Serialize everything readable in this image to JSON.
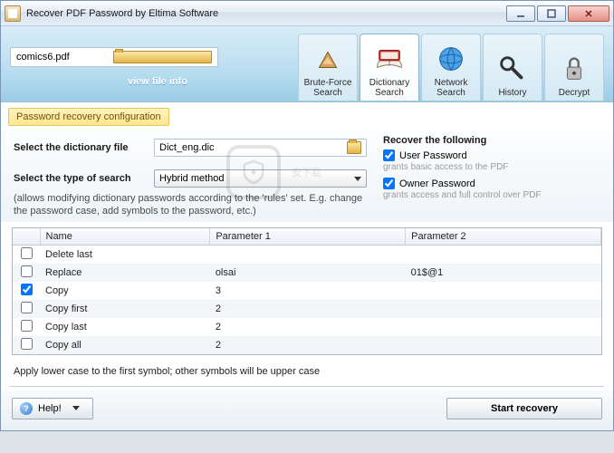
{
  "window": {
    "title": "Recover PDF Password by Eltima Software"
  },
  "file": {
    "name": "comics6.pdf",
    "view_info": "view file info"
  },
  "tabs": {
    "brute": "Brute-Force Search",
    "dict": "Dictionary Search",
    "net": "Network Search",
    "hist": "History",
    "decrypt": "Decrypt"
  },
  "section_title": "Password recovery configuration",
  "labels": {
    "dictfile": "Select the dictionary file",
    "searchtype": "Select the type of search"
  },
  "dictfile": "Dict_eng.dic",
  "searchtype": "Hybrid method",
  "search_note": "(allows modifying dictionary passwords according to the 'rules' set. E.g. change the password case, add symbols to the password, etc.)",
  "recover": {
    "title": "Recover the following",
    "user": "User Password",
    "user_desc": "grants basic access to the PDF",
    "owner": "Owner Password",
    "owner_desc": "grants access and full control over PDF"
  },
  "table": {
    "headers": {
      "name": "Name",
      "p1": "Parameter 1",
      "p2": "Parameter 2"
    },
    "rows": [
      {
        "checked": false,
        "name": "Delete last",
        "p1": "",
        "p2": ""
      },
      {
        "checked": false,
        "name": "Replace",
        "p1": "olsai",
        "p2": "01$@1"
      },
      {
        "checked": true,
        "name": "Copy",
        "p1": "3",
        "p2": ""
      },
      {
        "checked": false,
        "name": "Copy first",
        "p1": "2",
        "p2": ""
      },
      {
        "checked": false,
        "name": "Copy last",
        "p1": "2",
        "p2": ""
      },
      {
        "checked": false,
        "name": "Copy all",
        "p1": "2",
        "p2": ""
      }
    ]
  },
  "rule_desc": "Apply lower case to the first symbol; other symbols will be upper case",
  "buttons": {
    "help": "Help!",
    "start": "Start recovery"
  },
  "watermark": "安下载"
}
